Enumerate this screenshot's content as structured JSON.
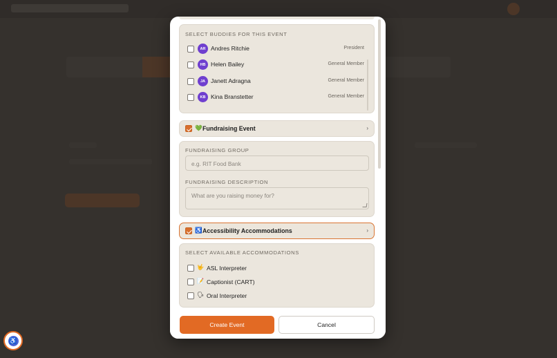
{
  "buddies": {
    "label": "SELECT BUDDIES FOR THIS EVENT",
    "items": [
      {
        "initials": "AR",
        "name": "Andres Ritchie",
        "role": "President"
      },
      {
        "initials": "HB",
        "name": "Helen Bailey",
        "role": "General Member"
      },
      {
        "initials": "JA",
        "name": "Janett Adragna",
        "role": "General Member"
      },
      {
        "initials": "KB",
        "name": "Kina Branstetter",
        "role": "General Member"
      }
    ]
  },
  "fundraising": {
    "toggle_icon": "💚",
    "toggle_label": "Fundraising Event",
    "checked": true,
    "group_label": "FUNDRAISING GROUP",
    "group_placeholder": "e.g. RIT Food Bank",
    "description_label": "FUNDRAISING DESCRIPTION",
    "description_placeholder": "What are you raising money for?"
  },
  "accessibility": {
    "toggle_icon": "♿",
    "toggle_label": "Accessibility Accommodations",
    "checked": true,
    "select_label": "SELECT AVAILABLE ACCOMMODATIONS",
    "items": [
      {
        "icon": "🤟",
        "label": "ASL Interpreter"
      },
      {
        "icon": "📝",
        "label": "Captionist (CART)"
      },
      {
        "icon": "🗣",
        "label": "Oral Interpreter"
      }
    ]
  },
  "footer": {
    "create_label": "Create Event",
    "cancel_label": "Cancel"
  },
  "floating": {
    "accessibility_icon": "♿"
  },
  "colors": {
    "accent": "#e26a24",
    "avatar": "#6f3fcf",
    "panel": "#ebe6dd"
  }
}
